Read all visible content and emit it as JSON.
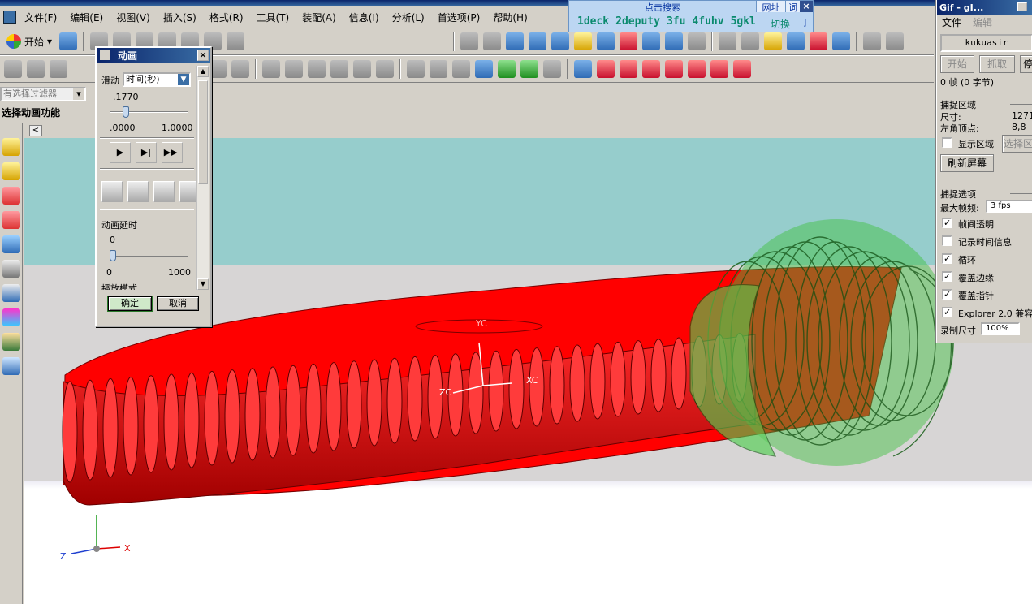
{
  "menu": {
    "items": [
      "文件(F)",
      "编辑(E)",
      "视图(V)",
      "插入(S)",
      "格式(R)",
      "工具(T)",
      "装配(A)",
      "信息(I)",
      "分析(L)",
      "首选项(P)",
      "帮助(H)"
    ]
  },
  "toolbar": {
    "start_label": "开始"
  },
  "filter": {
    "placeholder": "有选择过滤器"
  },
  "status": {
    "prompt": "选择动画功能"
  },
  "viewport": {
    "labels": {
      "yc": "YC",
      "xc": "XC",
      "zc": "ZC",
      "x": "X",
      "z": "Z"
    }
  },
  "animation_dialog": {
    "title": "动画",
    "slider_label": "滑动",
    "mode_value": "时间(秒)",
    "current_value": ".1770",
    "min_value": ".0000",
    "max_value": "1.0000",
    "slider_fraction": 0.177,
    "delay_label": "动画延时",
    "delay_value": "0",
    "delay_min": "0",
    "delay_max": "1000",
    "playback_label": "播放模式",
    "ok_label": "确定",
    "cancel_label": "取消"
  },
  "dictionary": {
    "search_label": "点击搜索",
    "tab_web": "网址",
    "tab_word": "词",
    "close": "×",
    "links": [
      "1deck",
      "2deputy",
      "3fu",
      "4fuhv",
      "5gkl"
    ],
    "switch_label": "切换",
    "bracket": "]"
  },
  "gif_panel": {
    "title": "Gif - gI...",
    "menu_file": "文件",
    "menu_edit": "编辑",
    "name": "kukuasir",
    "start_btn": "开始",
    "capture_btn": "抓取",
    "stop_btn": "停",
    "frames": "0 帧 (0 字节)",
    "capture_area": "捕捉区域",
    "size_label": "尺寸:",
    "size_value": "1271",
    "corner_label": "左角顶点:",
    "corner_value": "8,8",
    "show_area": "显示区域",
    "select_area_btn": "选择区",
    "refresh_btn": "刷新屏幕",
    "capture_options": "捕捉选项",
    "max_fps_label": "最大帧频:",
    "max_fps_value": "3 fps",
    "opt_transparent": "帧间透明",
    "opt_time": "记录时间信息",
    "opt_loop": "循环",
    "opt_border": "覆盖边缘",
    "opt_cursor": "覆盖指针",
    "opt_explorer": "Explorer 2.0 兼容",
    "record_size_label": "录制尺寸",
    "record_size_value": "100%"
  },
  "colors": {
    "worm_wheel": "#ff0000",
    "worm": "#3fbf3f",
    "sky": "#96cdcc",
    "title_blue": "#0a246a"
  }
}
